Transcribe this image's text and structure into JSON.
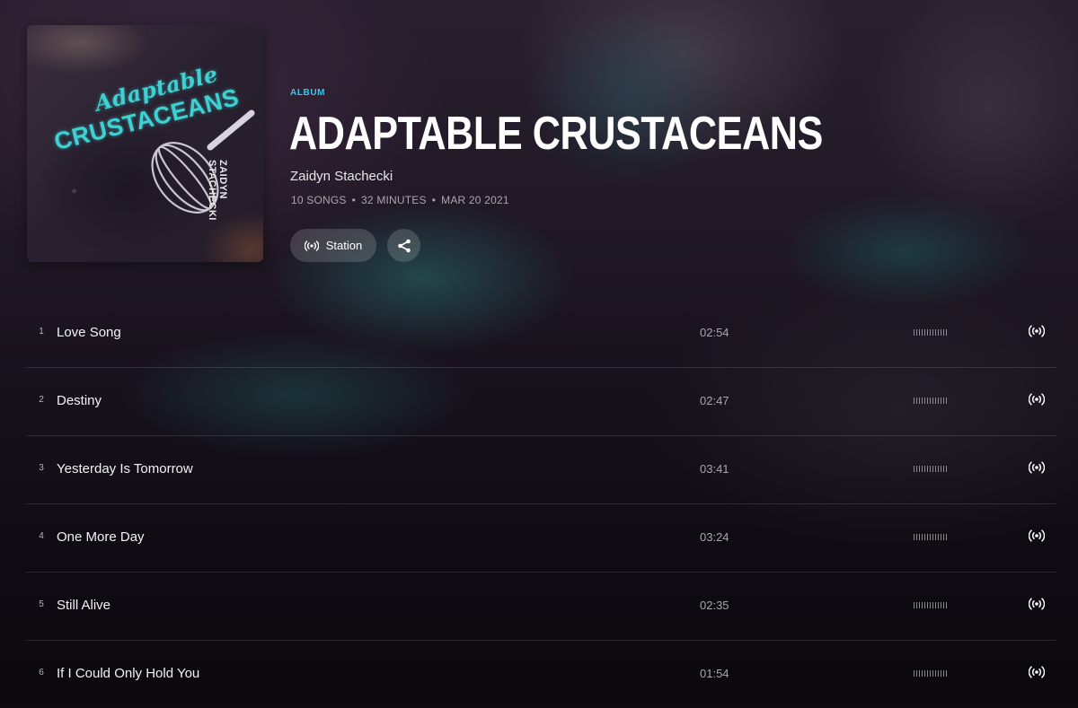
{
  "album": {
    "kind_label": "ALBUM",
    "title": "ADAPTABLE CRUSTACEANS",
    "artist": "Zaidyn Stachecki",
    "meta": {
      "songs": "10 SONGS",
      "duration": "32 MINUTES",
      "date": "MAR 20 2021"
    },
    "art": {
      "script_text": "Adaptable",
      "block_text": "CRUSTACEANS",
      "side_text": "ZAIDYN STACHECKI",
      "accent_color": "#3fd0d2"
    }
  },
  "actions": {
    "station_label": "Station",
    "station_icon": "station-broadcast-icon",
    "share_icon": "share-icon"
  },
  "tracks": [
    {
      "num": "1",
      "title": "Love Song",
      "duration": "02:54"
    },
    {
      "num": "2",
      "title": "Destiny",
      "duration": "02:47"
    },
    {
      "num": "3",
      "title": "Yesterday Is Tomorrow",
      "duration": "03:41"
    },
    {
      "num": "4",
      "title": "One More Day",
      "duration": "03:24"
    },
    {
      "num": "5",
      "title": "Still Alive",
      "duration": "02:35"
    },
    {
      "num": "6",
      "title": "If I Could Only Hold You",
      "duration": "01:54"
    }
  ],
  "colors": {
    "accent": "#3ec4e8",
    "text_primary": "#ffffff",
    "text_secondary": "#a9a6ad"
  }
}
